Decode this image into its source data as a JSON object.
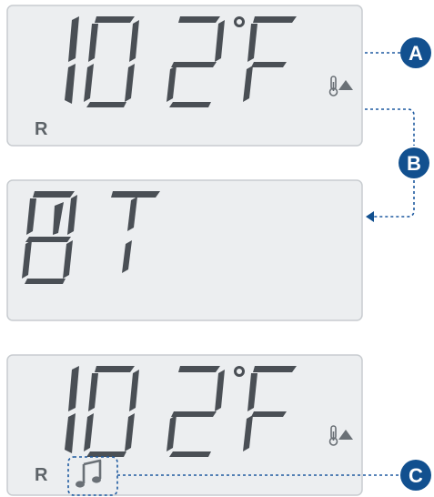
{
  "panels": [
    {
      "id": "panel-a",
      "display": "102°F",
      "digits": "102",
      "unit": "F",
      "mode": "R",
      "show_thermometer_up": true,
      "show_note": false
    },
    {
      "id": "panel-b",
      "display": "BT",
      "text": "BT",
      "mode": "",
      "show_thermometer_up": false,
      "show_note": false
    },
    {
      "id": "panel-c",
      "display": "102°F",
      "digits": "102",
      "unit": "F",
      "mode": "R",
      "show_thermometer_up": true,
      "show_note": true
    }
  ],
  "callouts": {
    "a": "A",
    "b": "B",
    "c": "C"
  },
  "icons": {
    "thermometer": "thermometer-icon",
    "up_arrow": "up-arrow-icon",
    "note": "music-note-icon"
  },
  "colors": {
    "callout": "#12508f",
    "panel_bg": "#eceef0",
    "segment": "#4a4f55"
  }
}
